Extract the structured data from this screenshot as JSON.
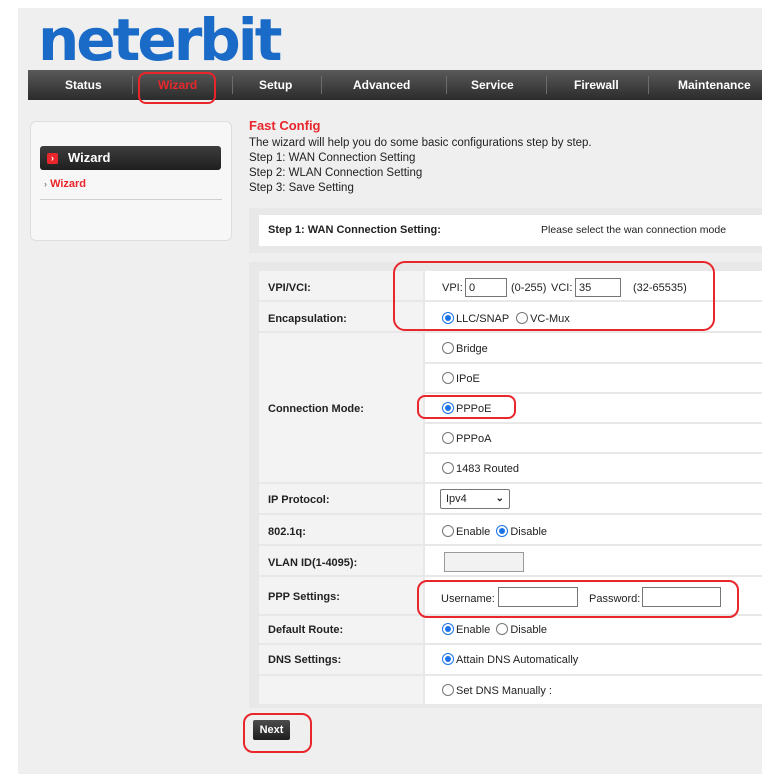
{
  "brand": {
    "logo_text": "neterbit",
    "logo_color": "#1a6bc7",
    "accent": "#e8262b"
  },
  "nav": {
    "items": [
      {
        "label": "Status"
      },
      {
        "label": "Wizard",
        "active": true
      },
      {
        "label": "Setup"
      },
      {
        "label": "Advanced"
      },
      {
        "label": "Service"
      },
      {
        "label": "Firewall"
      },
      {
        "label": "Maintenance"
      }
    ]
  },
  "sidebar": {
    "header": "Wizard",
    "link": "Wizard"
  },
  "intro": {
    "title": "Fast Config",
    "lines": [
      "The wizard will help you do some basic configurations step by step.",
      "Step 1: WAN Connection Setting",
      "Step 2: WLAN Connection Setting",
      "Step 3: Save Setting"
    ]
  },
  "step": {
    "label": "Step 1: WAN Connection Setting:",
    "hint": "Please select the wan connection mode"
  },
  "form": {
    "vpivci": {
      "label": "VPI/VCI:",
      "vpi_label": "VPI:",
      "vpi_value": "0",
      "vpi_range": "(0-255)",
      "vci_label": "VCI:",
      "vci_value": "35",
      "vci_range": "(32-65535)"
    },
    "encapsulation": {
      "label": "Encapsulation:",
      "options": [
        "LLC/SNAP",
        "VC-Mux"
      ],
      "selected": "LLC/SNAP"
    },
    "connection_mode": {
      "label": "Connection Mode:",
      "options": [
        "Bridge",
        "IPoE",
        "PPPoE",
        "PPPoA",
        "1483 Routed"
      ],
      "selected": "PPPoE"
    },
    "ip_protocol": {
      "label": "IP Protocol:",
      "value": "Ipv4"
    },
    "dot1q": {
      "label": "802.1q:",
      "options": [
        "Enable",
        "Disable"
      ],
      "selected": "Disable"
    },
    "vlan_id": {
      "label": "VLAN ID(1-4095):",
      "value": ""
    },
    "ppp": {
      "label": "PPP Settings:",
      "username_label": "Username:",
      "username_value": "",
      "password_label": "Password:",
      "password_value": ""
    },
    "default_route": {
      "label": "Default Route:",
      "options": [
        "Enable",
        "Disable"
      ],
      "selected": "Enable"
    },
    "dns": {
      "label": "DNS Settings:",
      "options": [
        "Attain DNS Automatically",
        "Set DNS Manually :"
      ],
      "selected": "Attain DNS Automatically"
    }
  },
  "next_button": "Next"
}
